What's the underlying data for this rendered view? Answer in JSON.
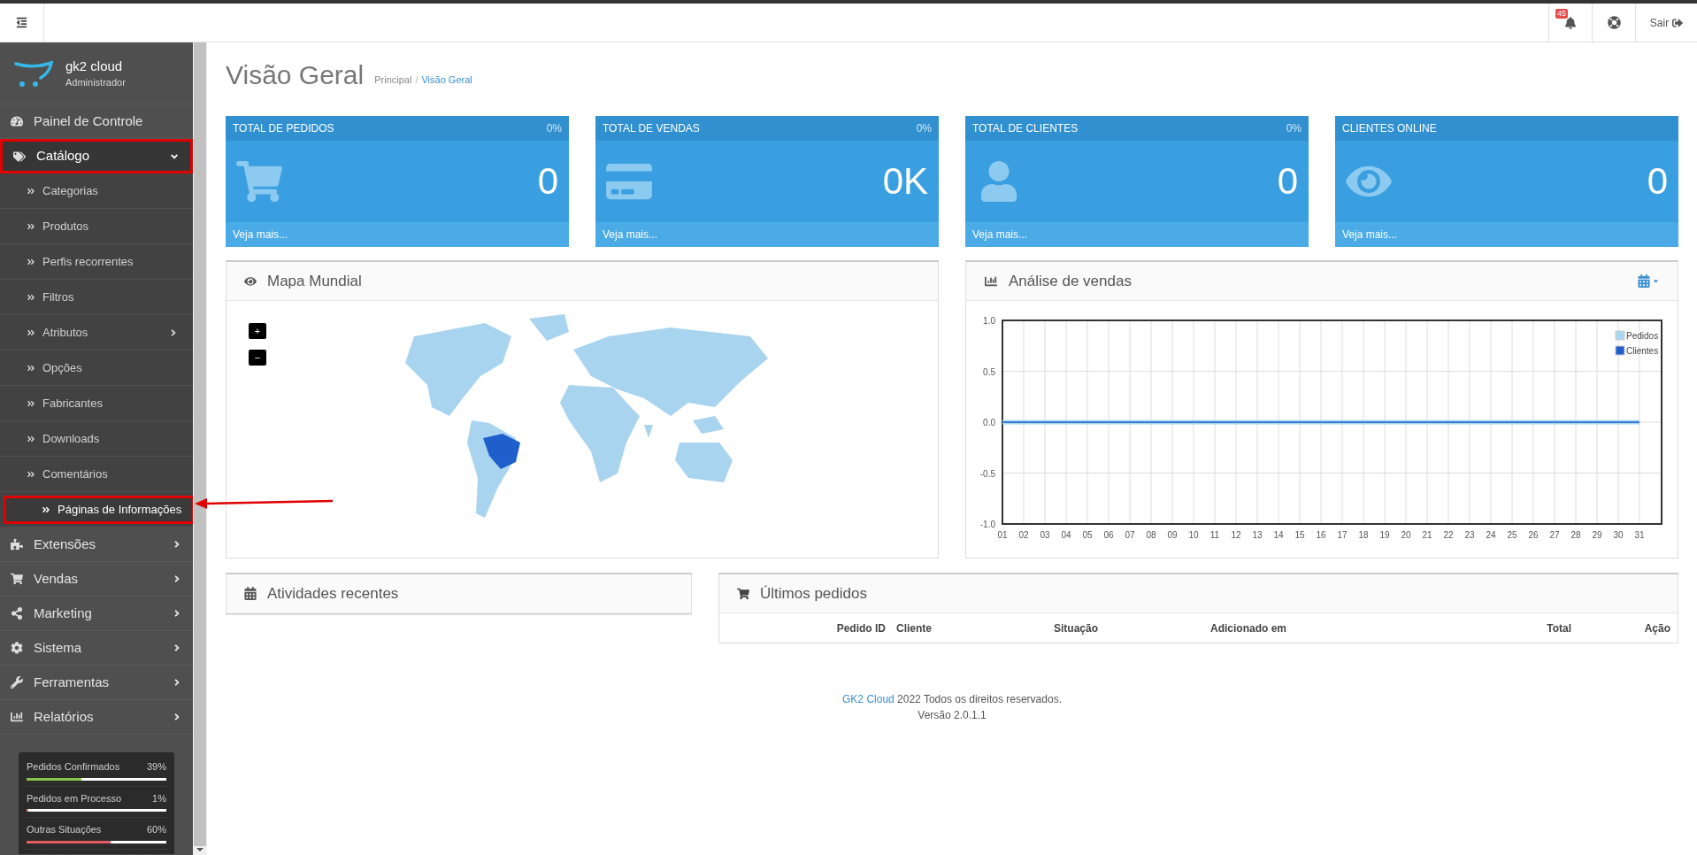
{
  "header": {
    "notifications": "45",
    "logout": "Sair"
  },
  "brand": {
    "name": "gk2 cloud",
    "role": "Administrador"
  },
  "sidebar": {
    "items": [
      {
        "label": "Painel de Controle",
        "kind": "link",
        "annotated": false
      },
      {
        "label": "Catálogo",
        "kind": "group",
        "expanded": true,
        "annotated": true,
        "children": [
          {
            "label": "Categorias",
            "kind": "link",
            "selected": false,
            "annotated": false
          },
          {
            "label": "Produtos",
            "kind": "link",
            "selected": false,
            "annotated": false
          },
          {
            "label": "Perfis recorrentes",
            "kind": "link",
            "selected": false,
            "annotated": false
          },
          {
            "label": "Filtros",
            "kind": "link",
            "selected": false,
            "annotated": false
          },
          {
            "label": "Atributos",
            "kind": "group",
            "expanded": false,
            "selected": false,
            "annotated": false
          },
          {
            "label": "Opções",
            "kind": "link",
            "selected": false,
            "annotated": false
          },
          {
            "label": "Fabricantes",
            "kind": "link",
            "selected": false,
            "annotated": false
          },
          {
            "label": "Downloads",
            "kind": "link",
            "selected": false,
            "annotated": false
          },
          {
            "label": "Comentários",
            "kind": "link",
            "selected": false,
            "annotated": false
          },
          {
            "label": "Páginas de Informações",
            "kind": "link",
            "selected": true,
            "annotated": true
          }
        ]
      },
      {
        "label": "Extensões",
        "kind": "group",
        "expanded": false,
        "annotated": false
      },
      {
        "label": "Vendas",
        "kind": "group",
        "expanded": false,
        "annotated": false
      },
      {
        "label": "Marketing",
        "kind": "group",
        "expanded": false,
        "annotated": false
      },
      {
        "label": "Sistema",
        "kind": "group",
        "expanded": false,
        "annotated": false
      },
      {
        "label": "Ferramentas",
        "kind": "group",
        "expanded": false,
        "annotated": false
      },
      {
        "label": "Relatórios",
        "kind": "group",
        "expanded": false,
        "annotated": false
      }
    ],
    "stats": [
      {
        "label": "Pedidos Confirmados",
        "reading": "39%",
        "level": 0.39,
        "color": "#8bc34a"
      },
      {
        "label": "Pedidos em Processo",
        "reading": "1%",
        "level": 0.01,
        "color": "#f0883a"
      },
      {
        "label": "Outras Situações",
        "reading": "60%",
        "level": 0.6,
        "color": "#e85a62"
      }
    ]
  },
  "page": {
    "title": "Visão Geral",
    "breadcrumb": [
      "Principal",
      "Visão Geral"
    ],
    "separator": "/"
  },
  "cards": [
    {
      "title": "TOTAL DE PEDIDOS",
      "percent": "0%",
      "value": "0",
      "footer": "Veja mais..."
    },
    {
      "title": "TOTAL DE VENDAS",
      "percent": "0%",
      "value": "0K",
      "footer": "Veja mais..."
    },
    {
      "title": "TOTAL DE CLIENTES",
      "percent": "0%",
      "value": "0",
      "footer": "Veja mais..."
    },
    {
      "title": "CLIENTES ONLINE",
      "value": "0",
      "footer": "Veja mais..."
    }
  ],
  "map_panel": {
    "title": "Mapa Mundial",
    "zoom_in": "+",
    "zoom_out": "−"
  },
  "sales_panel": {
    "title": "Análise de vendas",
    "chart_data": {
      "type": "line",
      "categories": [
        "01",
        "02",
        "03",
        "04",
        "05",
        "06",
        "07",
        "08",
        "09",
        "10",
        "11",
        "12",
        "13",
        "14",
        "15",
        "16",
        "17",
        "18",
        "19",
        "20",
        "21",
        "22",
        "23",
        "24",
        "25",
        "26",
        "27",
        "28",
        "29",
        "30",
        "31"
      ],
      "series": [
        {
          "name": "Pedidos",
          "color": "#a8d8f0",
          "values": [
            0,
            0,
            0,
            0,
            0,
            0,
            0,
            0,
            0,
            0,
            0,
            0,
            0,
            0,
            0,
            0,
            0,
            0,
            0,
            0,
            0,
            0,
            0,
            0,
            0,
            0,
            0,
            0,
            0,
            0,
            0
          ]
        },
        {
          "name": "Clientes",
          "color": "#1f5fcc",
          "values": [
            0,
            0,
            0,
            0,
            0,
            0,
            0,
            0,
            0,
            0,
            0,
            0,
            0,
            0,
            0,
            0,
            0,
            0,
            0,
            0,
            0,
            0,
            0,
            0,
            0,
            0,
            0,
            0,
            0,
            0,
            0
          ]
        }
      ],
      "grid": true,
      "legend": true,
      "ylim": [
        -1,
        1
      ],
      "yticks": [
        {
          "value": -1,
          "label": "-1.0"
        },
        {
          "value": -0.5,
          "label": "-0.5"
        },
        {
          "value": 0,
          "label": "0.0"
        },
        {
          "value": 0.5,
          "label": "0.5"
        },
        {
          "value": 1,
          "label": "1.0"
        }
      ]
    }
  },
  "activity_panel": {
    "title": "Atividades recentes"
  },
  "orders_panel": {
    "title": "Últimos pedidos",
    "columns": [
      "Pedido ID",
      "Cliente",
      "Situação",
      "Adicionado em",
      "Total",
      "Ação"
    ]
  },
  "footer": {
    "link": "GK2 Cloud",
    "text": "2022 Todos os direitos reservados.",
    "version": "Versão 2.0.1.1"
  }
}
